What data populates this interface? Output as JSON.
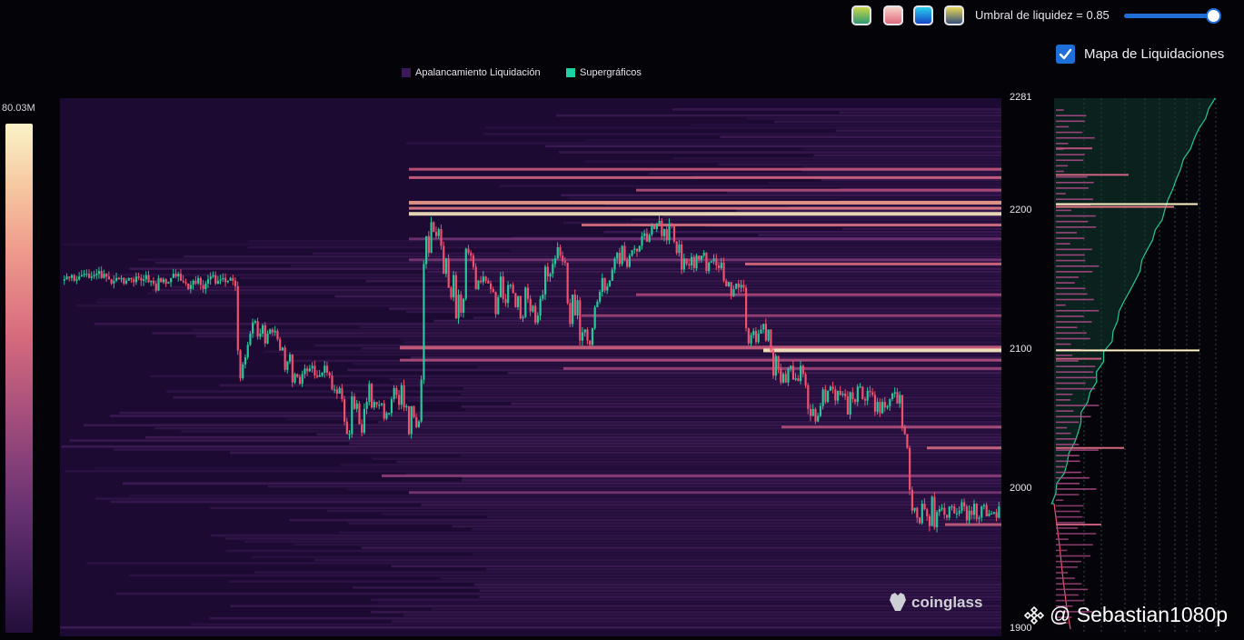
{
  "controls": {
    "palette_buttons": [
      {
        "name": "palette-viridis",
        "gradient": [
          "#2f9a73",
          "#c9d64a"
        ]
      },
      {
        "name": "palette-magma",
        "gradient": [
          "#e06a7e",
          "#f7d3c8"
        ]
      },
      {
        "name": "palette-blue",
        "gradient": [
          "#1446c6",
          "#2ad0f0"
        ]
      },
      {
        "name": "palette-cividis",
        "gradient": [
          "#37507a",
          "#e8d85b"
        ]
      }
    ],
    "threshold_label": "Umbral de liquidez = 0.85",
    "threshold_value": 0.85,
    "toggle_label": "Mapa de Liquidaciones",
    "toggle_checked": true
  },
  "legend": {
    "item1": "Apalancamiento Liquidación",
    "item1_color": "#3a1a5a",
    "item2": "Supergráficos",
    "item2_color": "#1fd0a0"
  },
  "colorbar": {
    "max_label": "80.03M"
  },
  "watermark": "coinglass",
  "author": "@ Sebastian1080p",
  "colors": {
    "up": "#26c89a",
    "down": "#f0506e",
    "background": "#1c0a33",
    "highlight": "#fff2c4"
  },
  "chart_data": {
    "type": "heatmap",
    "ylim": [
      1900,
      2281
    ],
    "y_ticks": [
      "2281",
      "2200",
      "2100",
      "2000",
      "1900"
    ],
    "price_path": [
      2150,
      2151,
      2153,
      2152,
      2154,
      2150,
      2151,
      2153,
      2154,
      2155,
      2155,
      2152,
      2153,
      2154,
      2155,
      2157,
      2152,
      2155,
      2153,
      2151,
      2148,
      2150,
      2152,
      2151,
      2152,
      2148,
      2150,
      2152,
      2151,
      2149,
      2153,
      2152,
      2150,
      2151,
      2154,
      2149,
      2150,
      2148,
      2143,
      2152,
      2149,
      2151,
      2148,
      2149,
      2152,
      2155,
      2153,
      2155,
      2150,
      2149,
      2148,
      2144,
      2147,
      2150,
      2148,
      2152,
      2147,
      2144,
      2148,
      2151,
      2153,
      2154,
      2148,
      2150,
      2151,
      2152,
      2149,
      2150,
      2152,
      2150,
      2146,
      2100,
      2080,
      2090,
      2095,
      2104,
      2112,
      2120,
      2121,
      2110,
      2112,
      2118,
      2105,
      2112,
      2115,
      2113,
      2114,
      2108,
      2100,
      2102,
      2086,
      2092,
      2097,
      2077,
      2083,
      2081,
      2076,
      2083,
      2087,
      2085,
      2087,
      2089,
      2082,
      2081,
      2082,
      2084,
      2089,
      2084,
      2082,
      2072,
      2072,
      2069,
      2073,
      2065,
      2049,
      2040,
      2040,
      2067,
      2058,
      2062,
      2047,
      2041,
      2058,
      2063,
      2076,
      2059,
      2063,
      2061,
      2061,
      2062,
      2051,
      2055,
      2055,
      2065,
      2073,
      2068,
      2061,
      2075,
      2059,
      2060,
      2040,
      2060,
      2052,
      2045,
      2049,
      2079,
      2162,
      2182,
      2170,
      2192,
      2185,
      2182,
      2187,
      2175,
      2155,
      2166,
      2145,
      2138,
      2154,
      2123,
      2140,
      2127,
      2137,
      2173,
      2170,
      2168,
      2160,
      2144,
      2150,
      2149,
      2153,
      2150,
      2148,
      2144,
      2142,
      2126,
      2138,
      2153,
      2137,
      2134,
      2147,
      2147,
      2141,
      2131,
      2139,
      2123,
      2124,
      2145,
      2137,
      2128,
      2132,
      2120,
      2125,
      2137,
      2140,
      2160,
      2153,
      2155,
      2162,
      2166,
      2174,
      2168,
      2164,
      2163,
      2134,
      2119,
      2140,
      2125,
      2136,
      2107,
      2113,
      2115,
      2107,
      2104,
      2116,
      2131,
      2135,
      2142,
      2152,
      2143,
      2146,
      2150,
      2158,
      2166,
      2170,
      2162,
      2175,
      2165,
      2160,
      2168,
      2172,
      2173,
      2171,
      2175,
      2182,
      2184,
      2178,
      2183,
      2190,
      2187,
      2191,
      2193,
      2182,
      2187,
      2179,
      2191,
      2189,
      2178,
      2170,
      2176,
      2158,
      2166,
      2162,
      2161,
      2167,
      2159,
      2168,
      2165,
      2168,
      2170,
      2157,
      2163,
      2164,
      2166,
      2161,
      2159,
      2163,
      2150,
      2146,
      2149,
      2139,
      2144,
      2148,
      2145,
      2147,
      2145,
      2116,
      2105,
      2111,
      2114,
      2106,
      2112,
      2115,
      2119,
      2107,
      2115,
      2100,
      2082,
      2096,
      2087,
      2077,
      2083,
      2077,
      2087,
      2089,
      2079,
      2080,
      2078,
      2089,
      2083,
      2075,
      2058,
      2053,
      2058,
      2049,
      2053,
      2060,
      2072,
      2063,
      2071,
      2074,
      2072,
      2064,
      2071,
      2068,
      2069,
      2067,
      2054,
      2070,
      2065,
      2063,
      2074,
      2074,
      2065,
      2064,
      2071,
      2070,
      2068,
      2056,
      2063,
      2055,
      2063,
      2059,
      2060,
      2065,
      2069,
      2070,
      2062,
      2068,
      2045,
      2040,
      2030,
      2000,
      1985,
      1987,
      1980,
      1976,
      1990,
      1986,
      1981,
      1974,
      1995,
      1973,
      1984,
      1986,
      1987,
      1982,
      1980,
      1988,
      1988,
      1983,
      1983,
      1985,
      1991,
      1988,
      1978,
      1985,
      1982,
      1990,
      1979,
      1980,
      1988,
      1989,
      1981,
      1983,
      1983,
      1984,
      1980,
      1988
    ]
  }
}
